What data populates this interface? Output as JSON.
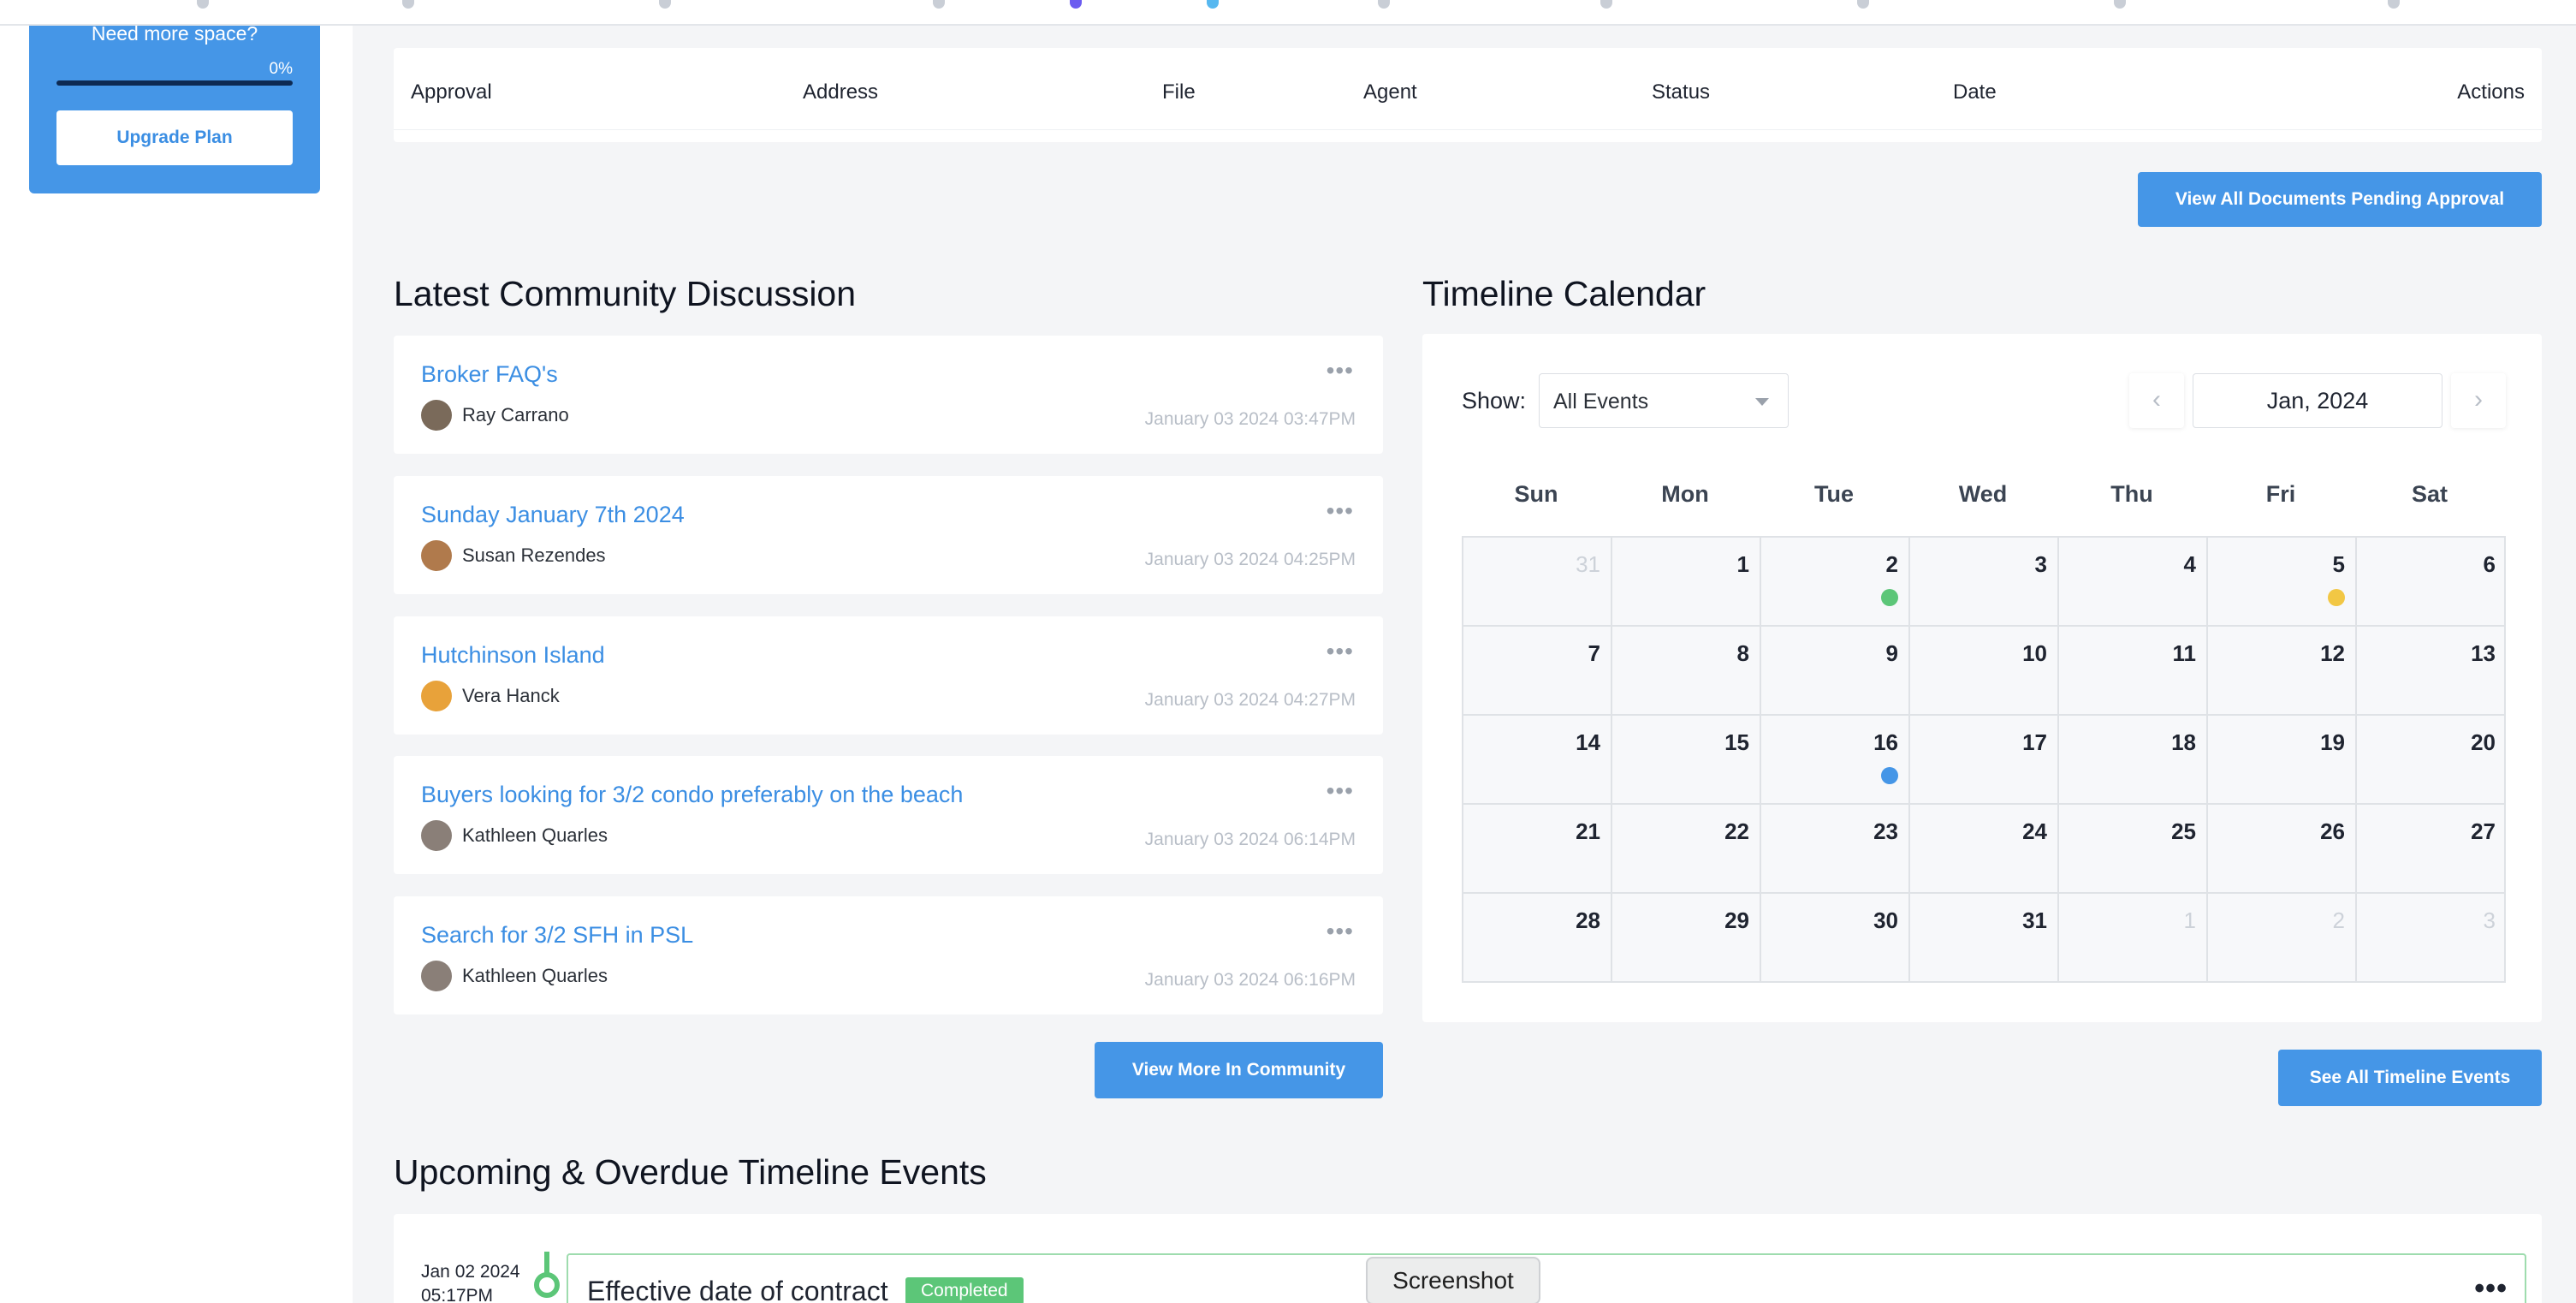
{
  "sidebar": {
    "storage": {
      "title": "Need more space?",
      "percent_label": "0%",
      "percent": 0,
      "upgrade_label": "Upgrade Plan"
    }
  },
  "approvals": {
    "columns": [
      "Approval",
      "Address",
      "File",
      "Agent",
      "Status",
      "Date",
      "Actions"
    ],
    "view_all_label": "View All Documents Pending Approval"
  },
  "community": {
    "title": "Latest Community Discussion",
    "posts": [
      {
        "title": "Broker FAQ's",
        "author": "Ray Carrano",
        "date": "January 03 2024 03:47PM",
        "avatar_color": "#7a6a5a"
      },
      {
        "title": "Sunday January 7th 2024",
        "author": "Susan Rezendes",
        "date": "January 03 2024 04:25PM",
        "avatar_color": "#b07a4c"
      },
      {
        "title": "Hutchinson Island",
        "author": "Vera Hanck",
        "date": "January 03 2024 04:27PM",
        "avatar_color": "#e8a23a"
      },
      {
        "title": "Buyers looking for 3/2 condo preferably on the beach",
        "author": "Kathleen Quarles",
        "date": "January 03 2024 06:14PM",
        "avatar_color": "#8a7f78"
      },
      {
        "title": "Search for 3/2 SFH in PSL",
        "author": "Kathleen Quarles",
        "date": "January 03 2024 06:16PM",
        "avatar_color": "#8a7f78"
      }
    ],
    "view_more_label": "View More In Community"
  },
  "calendar": {
    "title": "Timeline Calendar",
    "show_label": "Show:",
    "filter_value": "All Events",
    "prev_icon": "‹",
    "next_icon": "›",
    "month_label": "Jan, 2024",
    "weekdays": [
      "Sun",
      "Mon",
      "Tue",
      "Wed",
      "Thu",
      "Fri",
      "Sat"
    ],
    "days": [
      {
        "n": "31",
        "muted": true
      },
      {
        "n": "1"
      },
      {
        "n": "2",
        "event": "#5cc678"
      },
      {
        "n": "3"
      },
      {
        "n": "4"
      },
      {
        "n": "5",
        "event": "#f2c744"
      },
      {
        "n": "6"
      },
      {
        "n": "7"
      },
      {
        "n": "8"
      },
      {
        "n": "9"
      },
      {
        "n": "10"
      },
      {
        "n": "11"
      },
      {
        "n": "12"
      },
      {
        "n": "13"
      },
      {
        "n": "14"
      },
      {
        "n": "15"
      },
      {
        "n": "16",
        "event": "#4596e7"
      },
      {
        "n": "17"
      },
      {
        "n": "18"
      },
      {
        "n": "19"
      },
      {
        "n": "20"
      },
      {
        "n": "21"
      },
      {
        "n": "22"
      },
      {
        "n": "23"
      },
      {
        "n": "24"
      },
      {
        "n": "25"
      },
      {
        "n": "26"
      },
      {
        "n": "27"
      },
      {
        "n": "28"
      },
      {
        "n": "29"
      },
      {
        "n": "30"
      },
      {
        "n": "31"
      },
      {
        "n": "1",
        "muted": true
      },
      {
        "n": "2",
        "muted": true
      },
      {
        "n": "3",
        "muted": true
      }
    ],
    "see_all_label": "See All Timeline Events"
  },
  "timeline": {
    "title": "Upcoming & Overdue Timeline Events",
    "events": [
      {
        "date": "Jan 02 2024",
        "time": "05:17PM",
        "title": "Effective date of contract",
        "status": "Completed"
      }
    ]
  },
  "tooltip": {
    "label": "Screenshot"
  },
  "colors": {
    "accent": "#4596e7",
    "success": "#5cc678",
    "warning": "#f2c744"
  }
}
